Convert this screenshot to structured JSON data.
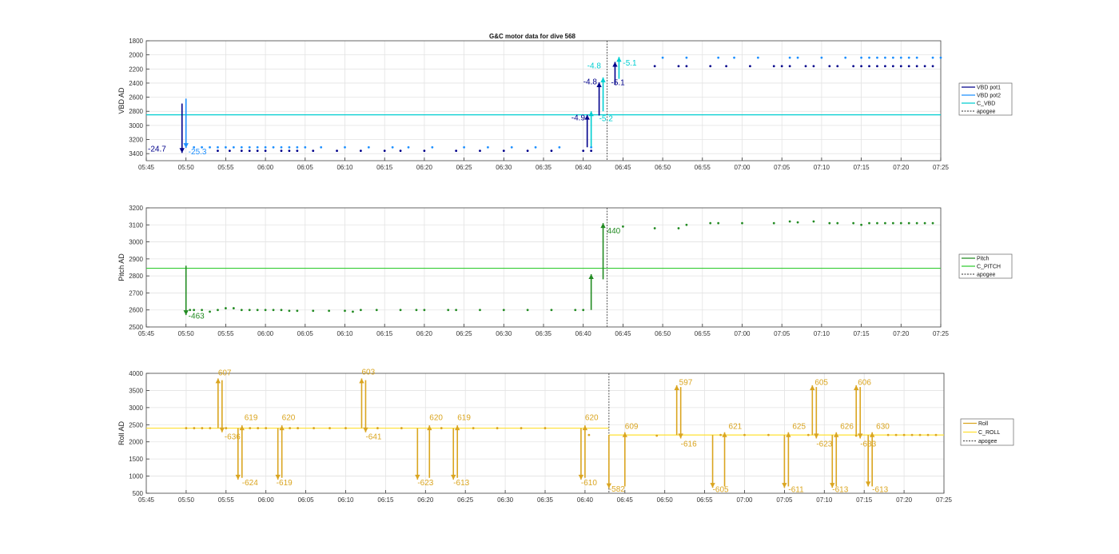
{
  "figure_title": "G&C motor data for dive 568",
  "chart_data": [
    {
      "type": "scatter",
      "ylabel": "VBD AD",
      "ylim": [
        1800,
        3500
      ],
      "yticks": [
        1800,
        2000,
        2200,
        2400,
        2600,
        2800,
        3000,
        3200,
        3400
      ],
      "y_reversed": true,
      "xlim": [
        "05:45",
        "07:25"
      ],
      "xticks": [
        "05:45",
        "05:50",
        "05:55",
        "06:00",
        "06:05",
        "06:10",
        "06:15",
        "06:20",
        "06:25",
        "06:30",
        "06:35",
        "06:40",
        "06:45",
        "06:50",
        "06:55",
        "07:00",
        "07:05",
        "07:10",
        "07:15",
        "07:20",
        "07:25"
      ],
      "grid": true,
      "legend_position": "right",
      "legend": [
        "VBD pot1",
        "VBD pot2",
        "C_VBD",
        "apogee"
      ],
      "colors": {
        "pot1": "#00008b",
        "pot2": "#1e90ff",
        "cref": "#00ced1",
        "apogee": "#555555"
      },
      "hline": 2850,
      "apogee": "06:43",
      "series": [
        {
          "name": "VBD pot1",
          "x": [
            "05:54",
            "05:55.5",
            "05:57",
            "05:58",
            "05:59",
            "06:00",
            "06:02",
            "06:03",
            "06:04",
            "06:06",
            "06:09",
            "06:12",
            "06:15",
            "06:17",
            "06:20",
            "06:24",
            "06:27",
            "06:30",
            "06:33",
            "06:36",
            "06:40",
            "06:41",
            "06:49",
            "06:52",
            "06:53",
            "06:56",
            "06:58",
            "07:01",
            "07:04",
            "07:05",
            "07:06",
            "07:08",
            "07:09",
            "07:11",
            "07:12",
            "07:14",
            "07:15",
            "07:16",
            "07:17",
            "07:18",
            "07:19",
            "07:20",
            "07:21",
            "07:22",
            "07:23",
            "07:24"
          ],
          "values": [
            3360,
            3360,
            3360,
            3360,
            3360,
            3360,
            3360,
            3360,
            3360,
            3360,
            3360,
            3360,
            3360,
            3360,
            3360,
            3360,
            3360,
            3360,
            3360,
            3360,
            3360,
            3360,
            2160,
            2160,
            2160,
            2160,
            2160,
            2160,
            2160,
            2160,
            2160,
            2160,
            2160,
            2160,
            2160,
            2160,
            2160,
            2160,
            2160,
            2160,
            2160,
            2160,
            2160,
            2160,
            2160,
            2160
          ]
        },
        {
          "name": "VBD pot2",
          "x": [
            "05:51",
            "05:52",
            "05:53",
            "05:54",
            "05:55",
            "05:56",
            "05:57",
            "05:58",
            "05:59",
            "06:00",
            "06:01",
            "06:02",
            "06:03",
            "06:04",
            "06:05",
            "06:07",
            "06:10",
            "06:13",
            "06:16",
            "06:18",
            "06:21",
            "06:25",
            "06:28",
            "06:31",
            "06:34",
            "06:37",
            "06:41",
            "06:50",
            "06:53",
            "06:57",
            "06:59",
            "07:02",
            "07:06",
            "07:07",
            "07:10",
            "07:13",
            "07:15",
            "07:16",
            "07:17",
            "07:18",
            "07:19",
            "07:20",
            "07:21",
            "07:22",
            "07:24",
            "07:25"
          ],
          "values": [
            3310,
            3310,
            3310,
            3310,
            3310,
            3310,
            3310,
            3310,
            3310,
            3310,
            3310,
            3310,
            3310,
            3310,
            3310,
            3310,
            3310,
            3310,
            3310,
            3310,
            3310,
            3310,
            3310,
            3310,
            3310,
            3310,
            3310,
            2040,
            2040,
            2040,
            2040,
            2040,
            2040,
            2040,
            2040,
            2040,
            2040,
            2040,
            2040,
            2040,
            2040,
            2040,
            2040,
            2040,
            2040,
            2040
          ]
        },
        {
          "name": "C_VBD",
          "x": [
            "05:45",
            "07:25"
          ],
          "values": [
            2850,
            2850
          ]
        }
      ],
      "arrows": [
        {
          "color": "pot1",
          "x": "05:49.5",
          "from": 2690,
          "to": 3390,
          "label": "-24.7",
          "label_x": "05:45.2",
          "label_y": 3370
        },
        {
          "color": "pot2",
          "x": "05:50",
          "from": 2620,
          "to": 3320,
          "label": "-25.3",
          "label_x": "05:50.3",
          "label_y": 3410
        },
        {
          "color": "pot1",
          "x": "06:40.5",
          "from": 3310,
          "to": 2850,
          "label": "-4.9",
          "label_x": "06:38.5",
          "label_y": 2930
        },
        {
          "color": "cref",
          "x": "06:41",
          "from": 3300,
          "to": 2800,
          "label": "-5.2",
          "label_x": "06:42",
          "label_y": 2940
        },
        {
          "color": "pot1",
          "x": "06:42",
          "from": 2860,
          "to": 2390,
          "label": "-4.8",
          "label_x": "06:40",
          "label_y": 2420
        },
        {
          "color": "cref",
          "x": "06:42.5",
          "from": 2800,
          "to": 2320,
          "label": "-4.8",
          "label_x": "06:40.5",
          "label_y": 2190
        },
        {
          "color": "pot1",
          "x": "06:44",
          "from": 2420,
          "to": 2100,
          "label": "-5.1",
          "label_x": "06:43.5",
          "label_y": 2430
        },
        {
          "color": "cref",
          "x": "06:44.5",
          "from": 2340,
          "to": 2030,
          "label": "-5.1",
          "label_x": "06:45",
          "label_y": 2150
        }
      ]
    },
    {
      "type": "scatter",
      "ylabel": "Pitch AD",
      "ylim": [
        2500,
        3200
      ],
      "yticks": [
        2500,
        2600,
        2700,
        2800,
        2900,
        3000,
        3100,
        3200
      ],
      "xlim": [
        "05:45",
        "07:25"
      ],
      "xticks": [
        "05:45",
        "05:50",
        "05:55",
        "06:00",
        "06:05",
        "06:10",
        "06:15",
        "06:20",
        "06:25",
        "06:30",
        "06:35",
        "06:40",
        "06:45",
        "06:50",
        "06:55",
        "07:00",
        "07:05",
        "07:10",
        "07:15",
        "07:20",
        "07:25"
      ],
      "grid": true,
      "legend_position": "right",
      "legend": [
        "Pitch",
        "C_PITCH",
        "apogee"
      ],
      "colors": {
        "pitch": "#228b22",
        "cref": "#33cc33",
        "apogee": "#555555"
      },
      "hline": 2845,
      "apogee": "06:43",
      "series": [
        {
          "name": "Pitch",
          "x": [
            "05:50.5",
            "05:51",
            "05:52",
            "05:53",
            "05:54",
            "05:55",
            "05:56",
            "05:57",
            "05:58",
            "05:59",
            "06:00",
            "06:01",
            "06:02",
            "06:03",
            "06:04",
            "06:06",
            "06:08",
            "06:10",
            "06:11",
            "06:12",
            "06:14",
            "06:17",
            "06:19",
            "06:20",
            "06:23",
            "06:24",
            "06:27",
            "06:30",
            "06:33",
            "06:36",
            "06:39",
            "06:40",
            "06:45",
            "06:49",
            "06:52",
            "06:53",
            "06:56",
            "06:57",
            "07:00",
            "07:04",
            "07:06",
            "07:07",
            "07:09",
            "07:11",
            "07:12",
            "07:14",
            "07:15",
            "07:16",
            "07:17",
            "07:18",
            "07:19",
            "07:20",
            "07:21",
            "07:22",
            "07:23",
            "07:24"
          ],
          "values": [
            2600,
            2600,
            2600,
            2590,
            2600,
            2610,
            2610,
            2600,
            2600,
            2600,
            2600,
            2600,
            2600,
            2595,
            2595,
            2595,
            2595,
            2595,
            2590,
            2600,
            2600,
            2600,
            2600,
            2600,
            2600,
            2600,
            2600,
            2600,
            2600,
            2600,
            2600,
            2600,
            3090,
            3080,
            3080,
            3100,
            3110,
            3110,
            3110,
            3110,
            3120,
            3115,
            3120,
            3110,
            3110,
            3110,
            3100,
            3110,
            3110,
            3110,
            3110,
            3110,
            3110,
            3110,
            3110,
            3110
          ]
        },
        {
          "name": "C_PITCH",
          "x": [
            "05:45",
            "07:25"
          ],
          "values": [
            2845,
            2845
          ]
        }
      ],
      "arrows": [
        {
          "color": "pitch",
          "x": "05:50",
          "from": 2860,
          "to": 2570,
          "label": "-463",
          "label_x": "05:50.3",
          "label_y": 2550
        },
        {
          "color": "pitch",
          "x": "06:41",
          "from": 2600,
          "to": 2810,
          "label": "",
          "label_x": "06:41",
          "label_y": 2600
        },
        {
          "color": "pitch",
          "x": "06:42.5",
          "from": 2780,
          "to": 3110,
          "label": "440",
          "label_x": "06:43",
          "label_y": 3050
        }
      ]
    },
    {
      "type": "scatter",
      "ylabel": "Roll AD",
      "ylim": [
        500,
        4000
      ],
      "yticks": [
        500,
        1000,
        1500,
        2000,
        2500,
        3000,
        3500,
        4000
      ],
      "xlim": [
        "05:45",
        "07:25"
      ],
      "xticks": [
        "05:45",
        "05:50",
        "05:55",
        "06:00",
        "06:05",
        "06:10",
        "06:15",
        "06:20",
        "06:25",
        "06:30",
        "06:35",
        "06:40",
        "06:45",
        "06:50",
        "06:55",
        "07:00",
        "07:05",
        "07:10",
        "07:15",
        "07:20",
        "07:25"
      ],
      "grid": true,
      "legend_position": "right",
      "legend": [
        "Roll",
        "C_ROLL",
        "apogee"
      ],
      "colors": {
        "roll": "#daa520",
        "cref": "#ffe033",
        "apogee": "#555555"
      },
      "hline_segments": [
        {
          "x": [
            "05:45",
            "06:43"
          ],
          "value": 2400
        },
        {
          "x": [
            "06:43",
            "07:25"
          ],
          "value": 2200
        }
      ],
      "apogee": "06:43",
      "series": [
        {
          "name": "Roll",
          "x": [
            "05:50",
            "05:51",
            "05:52",
            "05:53",
            "05:55",
            "05:58",
            "05:59",
            "06:00",
            "06:03",
            "06:04",
            "06:06",
            "06:08",
            "06:10",
            "06:14",
            "06:17",
            "06:22",
            "06:26",
            "06:29",
            "06:32",
            "06:35",
            "06:40.5",
            "06:49",
            "06:57",
            "07:00",
            "07:03",
            "07:08",
            "07:14",
            "07:18",
            "07:19",
            "07:20",
            "07:21",
            "07:22",
            "07:23",
            "07:24"
          ],
          "values": [
            2400,
            2400,
            2400,
            2400,
            2400,
            2400,
            2400,
            2400,
            2400,
            2400,
            2400,
            2400,
            2400,
            2400,
            2400,
            2400,
            2400,
            2400,
            2400,
            2400,
            2200,
            2180,
            2200,
            2200,
            2200,
            2200,
            2180,
            2200,
            2200,
            2200,
            2200,
            2200,
            2200,
            2200
          ]
        },
        {
          "name": "C_ROLL",
          "x": [
            "05:45",
            "07:25"
          ],
          "values": [
            2400,
            2200
          ]
        }
      ],
      "arrows": [
        {
          "x": "05:54",
          "from": 2400,
          "to": 3850,
          "label": "607",
          "label_x": "05:54",
          "label_y": 3940
        },
        {
          "x": "05:54.5",
          "from": 3800,
          "to": 2280,
          "label": "-636",
          "label_x": "05:54.8",
          "label_y": 2080
        },
        {
          "x": "05:56.5",
          "from": 2400,
          "to": 900,
          "label": "-624",
          "label_x": "05:57",
          "label_y": 730
        },
        {
          "x": "05:57",
          "from": 950,
          "to": 2480,
          "label": "619",
          "label_x": "05:57.3",
          "label_y": 2630
        },
        {
          "x": "06:01.5",
          "from": 2400,
          "to": 900,
          "label": "-619",
          "label_x": "06:01.3",
          "label_y": 730
        },
        {
          "x": "06:02",
          "from": 950,
          "to": 2480,
          "label": "620",
          "label_x": "06:02",
          "label_y": 2630
        },
        {
          "x": "06:12",
          "from": 2400,
          "to": 3850,
          "label": "603",
          "label_x": "06:12",
          "label_y": 3960
        },
        {
          "x": "06:12.5",
          "from": 3800,
          "to": 2280,
          "label": "-641",
          "label_x": "06:12.5",
          "label_y": 2080
        },
        {
          "x": "06:19",
          "from": 2400,
          "to": 900,
          "label": "-623",
          "label_x": "06:19",
          "label_y": 730
        },
        {
          "x": "06:20.5",
          "from": 950,
          "to": 2480,
          "label": "620",
          "label_x": "06:20.5",
          "label_y": 2630
        },
        {
          "x": "06:23.5",
          "from": 2400,
          "to": 900,
          "label": "-613",
          "label_x": "06:23.5",
          "label_y": 730
        },
        {
          "x": "06:24",
          "from": 950,
          "to": 2480,
          "label": "619",
          "label_x": "06:24",
          "label_y": 2630
        },
        {
          "x": "06:39.5",
          "from": 2400,
          "to": 900,
          "label": "-610",
          "label_x": "06:39.5",
          "label_y": 730
        },
        {
          "x": "06:40",
          "from": 950,
          "to": 2480,
          "label": "620",
          "label_x": "06:40",
          "label_y": 2630
        },
        {
          "x": "06:43",
          "from": 2200,
          "to": 650,
          "label": "-582",
          "label_x": "06:43",
          "label_y": 550
        },
        {
          "x": "06:45",
          "from": 700,
          "to": 2280,
          "label": "609",
          "label_x": "06:45",
          "label_y": 2380
        },
        {
          "x": "06:51.5",
          "from": 2200,
          "to": 3650,
          "label": "597",
          "label_x": "06:51.8",
          "label_y": 3660
        },
        {
          "x": "06:52",
          "from": 3600,
          "to": 2100,
          "label": "-616",
          "label_x": "06:52",
          "label_y": 1870
        },
        {
          "x": "06:56",
          "from": 2200,
          "to": 660,
          "label": "-605",
          "label_x": "06:56",
          "label_y": 530
        },
        {
          "x": "06:57.5",
          "from": 700,
          "to": 2280,
          "label": "621",
          "label_x": "06:58",
          "label_y": 2380
        },
        {
          "x": "07:05",
          "from": 2200,
          "to": 660,
          "label": "-611",
          "label_x": "07:05.5",
          "label_y": 530
        },
        {
          "x": "07:05.5",
          "from": 700,
          "to": 2280,
          "label": "625",
          "label_x": "07:06",
          "label_y": 2380
        },
        {
          "x": "07:08.5",
          "from": 2200,
          "to": 3650,
          "label": "605",
          "label_x": "07:08.8",
          "label_y": 3660
        },
        {
          "x": "07:09",
          "from": 3600,
          "to": 2100,
          "label": "-623",
          "label_x": "07:09",
          "label_y": 1870
        },
        {
          "x": "07:11",
          "from": 2200,
          "to": 660,
          "label": "-613",
          "label_x": "07:11",
          "label_y": 530
        },
        {
          "x": "07:11.5",
          "from": 700,
          "to": 2280,
          "label": "626",
          "label_x": "07:12",
          "label_y": 2380
        },
        {
          "x": "07:14",
          "from": 2200,
          "to": 3650,
          "label": "606",
          "label_x": "07:14.2",
          "label_y": 3660
        },
        {
          "x": "07:14.5",
          "from": 3600,
          "to": 2100,
          "label": "-633",
          "label_x": "07:14.5",
          "label_y": 1870
        },
        {
          "x": "07:15.5",
          "from": 2200,
          "to": 700,
          "label": "-613",
          "label_x": "07:16",
          "label_y": 530
        },
        {
          "x": "07:16",
          "from": 700,
          "to": 2280,
          "label": "630",
          "label_x": "07:16.5",
          "label_y": 2380
        }
      ]
    }
  ]
}
